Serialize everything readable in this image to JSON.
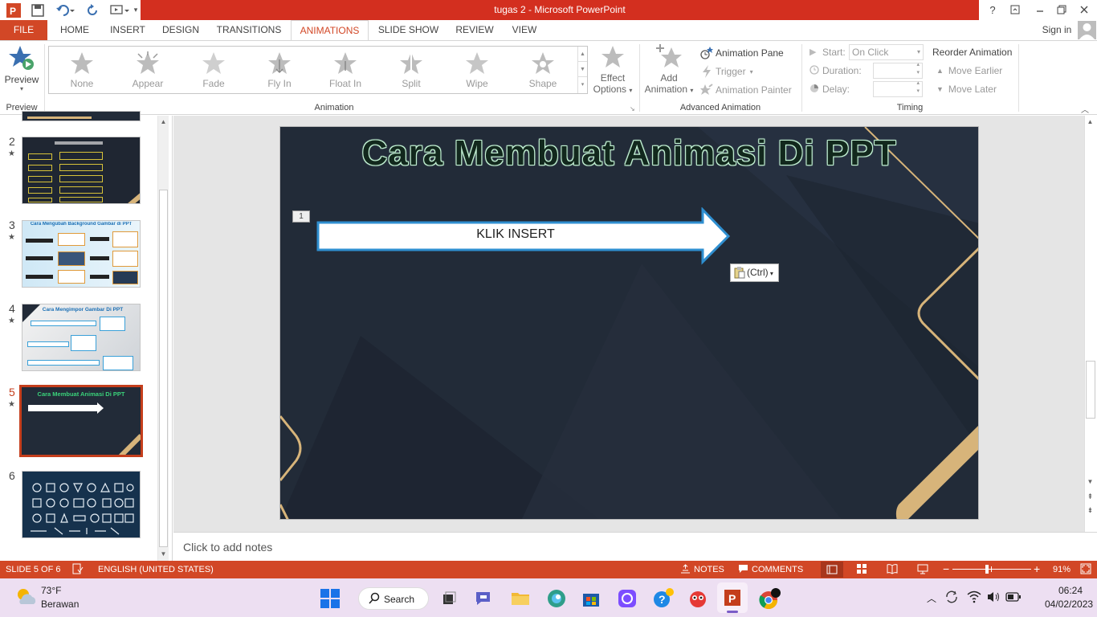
{
  "window": {
    "title": "tugas 2 -  Microsoft PowerPoint",
    "help": "?",
    "signin": "Sign in"
  },
  "tabs": [
    {
      "label": "FILE"
    },
    {
      "label": "HOME"
    },
    {
      "label": "INSERT"
    },
    {
      "label": "DESIGN"
    },
    {
      "label": "TRANSITIONS"
    },
    {
      "label": "ANIMATIONS"
    },
    {
      "label": "SLIDE SHOW"
    },
    {
      "label": "REVIEW"
    },
    {
      "label": "VIEW"
    }
  ],
  "ribbon": {
    "preview": {
      "label": "Preview",
      "group": "Preview"
    },
    "animation_group": "Animation",
    "gallery": [
      "None",
      "Appear",
      "Fade",
      "Fly In",
      "Float In",
      "Split",
      "Wipe",
      "Shape"
    ],
    "effect_options": {
      "line1": "Effect",
      "line2": "Options"
    },
    "add_animation": {
      "line1": "Add",
      "line2": "Animation"
    },
    "animation_pane": "Animation Pane",
    "trigger": "Trigger",
    "animation_painter": "Animation Painter",
    "advanced_group": "Advanced Animation",
    "start_label": "Start:",
    "start_value": "On Click",
    "duration_label": "Duration:",
    "delay_label": "Delay:",
    "timing_group": "Timing",
    "reorder": "Reorder Animation",
    "move_earlier": "Move Earlier",
    "move_later": "Move Later"
  },
  "slides_pane": {
    "numbers": [
      "2",
      "3",
      "4",
      "5",
      "6"
    ],
    "thumb_titles": {
      "s3": "Cara Mengubah Background Gambar di PPT",
      "s4": "Cara Mengimpor Gambar Di PPT",
      "s5": "Cara Membuat Animasi Di PPT"
    }
  },
  "slide": {
    "title": "Cara Membuat Animasi Di PPT",
    "anim_tag": "1",
    "arrow_text": "KLIK INSERT",
    "paste": "(Ctrl)"
  },
  "notes": "Click to add notes",
  "status": {
    "slide": "SLIDE 5 OF 6",
    "language": "ENGLISH (UNITED STATES)",
    "notes": "NOTES",
    "comments": "COMMENTS",
    "zoom": "91%",
    "zoom_fraction": 0.91
  },
  "taskbar": {
    "temp": "73°F",
    "weather": "Berawan",
    "search": "Search",
    "time": "06:24",
    "date": "04/02/2023"
  },
  "colors": {
    "accent": "#d24726",
    "title_red": "#d32f1f",
    "slide_bg": "#222b38",
    "gold": "#d7b47a"
  }
}
